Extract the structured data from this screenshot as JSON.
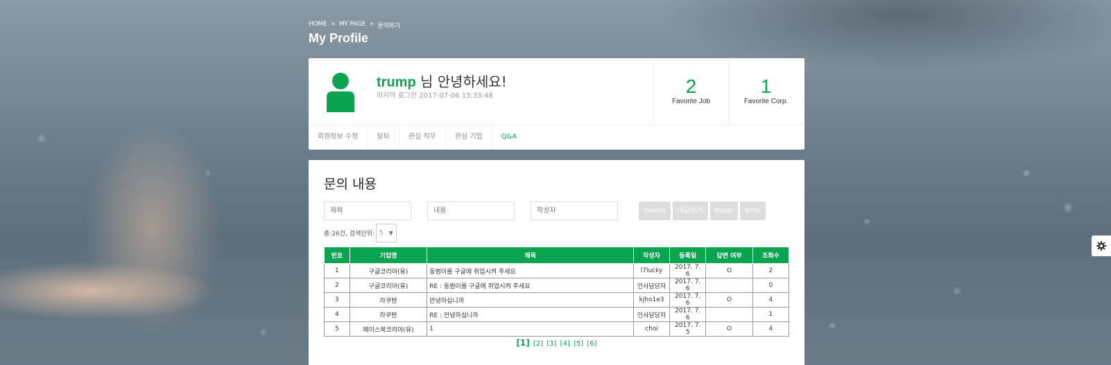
{
  "breadcrumb": [
    "HOME",
    "MY PAGE",
    "문의하기"
  ],
  "page_title": "My Profile",
  "profile": {
    "username": "trump",
    "greeting_suffix": " 님 안녕하세요!",
    "last_login": "마지막 로그인 2017-07-06 15:33:48",
    "stats": [
      {
        "num": "2",
        "label": "Favorite Job"
      },
      {
        "num": "1",
        "label": "Favorite Corp."
      }
    ]
  },
  "tabs": [
    "회원정보 수정",
    "탈퇴",
    "관심 직무",
    "관심 기업",
    "Q&A"
  ],
  "section_title": "문의 내용",
  "search": {
    "title_placeholder": "제목",
    "content_placeholder": "내용",
    "author_placeholder": "작성자",
    "buttons": [
      "Search",
      "내글보기",
      "Reset",
      "Write"
    ]
  },
  "meta": {
    "summary": "총:26건, 검색단위:",
    "unit": "5"
  },
  "table": {
    "headers": [
      "번호",
      "기업명",
      "제목",
      "작성자",
      "등록일",
      "답변 여부",
      "조회수"
    ],
    "rows": [
      [
        "1",
        "구글코리아(유)",
        "동범이를 구글에 취업시켜 주세요",
        "l7lucky",
        "2017. 7. 6",
        "O",
        "2"
      ],
      [
        "2",
        "구글코리아(유)",
        "RE : 동범이를 구글에 취업시켜 주세요",
        "인사담당자",
        "2017. 7. 6",
        "",
        "0"
      ],
      [
        "3",
        "라쿠텐",
        "안녕하십니까",
        "kjho1e3",
        "2017. 7. 6",
        "O",
        "4"
      ],
      [
        "4",
        "라쿠텐",
        "RE : 안녕하십니까",
        "인사담당자",
        "2017. 7. 6",
        "",
        "1"
      ],
      [
        "5",
        "페이스북코리아(유)",
        "1",
        "choi",
        "2017. 7. 5",
        "O",
        "4"
      ]
    ]
  },
  "pager": [
    "[1]",
    "[2]",
    "[3]",
    "[4]",
    "[5]",
    "[6]"
  ],
  "colors": {
    "accent": "#0aa34f"
  }
}
